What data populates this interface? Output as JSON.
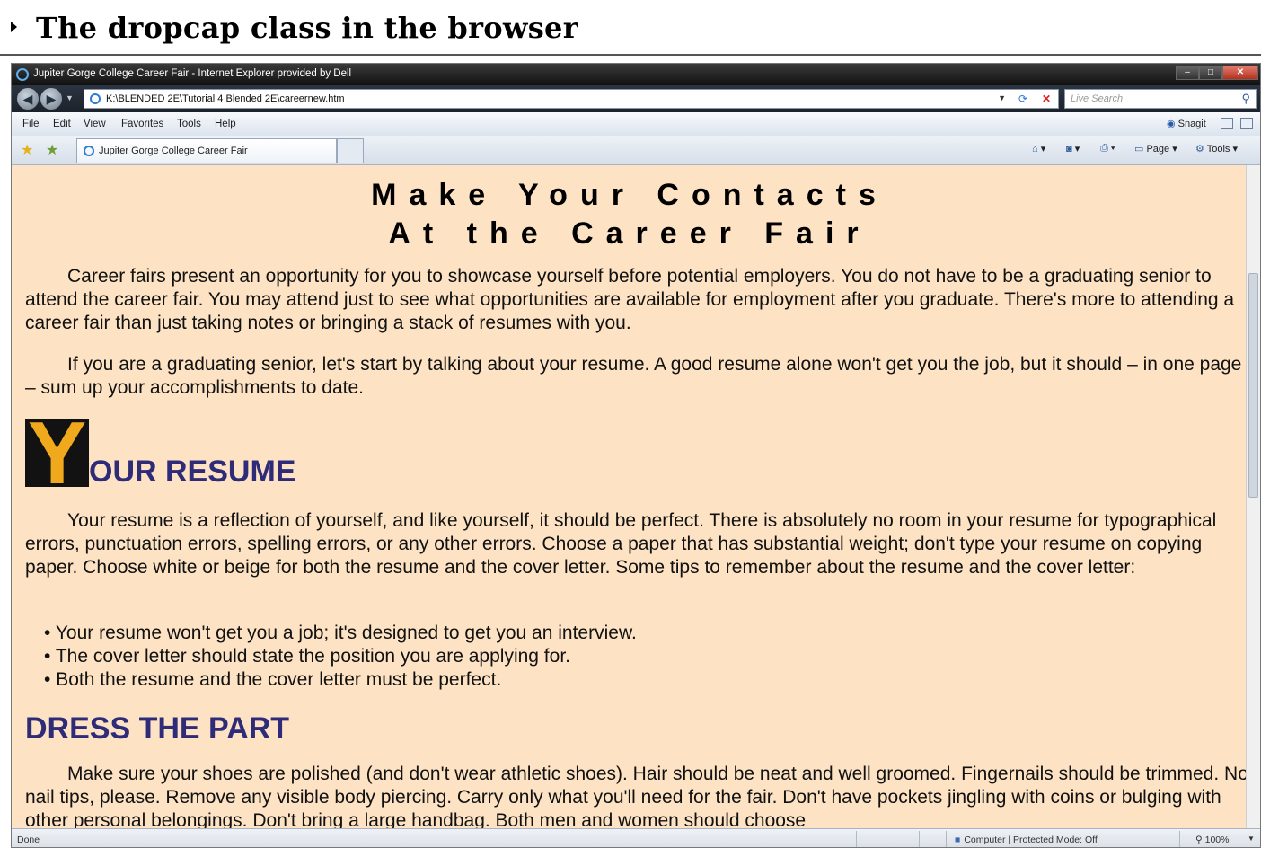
{
  "figure": {
    "caption": "The dropcap class in the browser"
  },
  "window": {
    "title": "Jupiter Gorge College Career Fair - Internet Explorer provided by Dell"
  },
  "address_bar": {
    "url": "K:\\BLENDED 2E\\Tutorial 4 Blended 2E\\careernew.htm",
    "search_placeholder": "Live Search"
  },
  "menu": {
    "items": [
      "File",
      "Edit",
      "View",
      "Favorites",
      "Tools",
      "Help"
    ],
    "snagit": "Snagit"
  },
  "tabs": [
    {
      "label": "Jupiter Gorge College Career Fair"
    }
  ],
  "command_bar": {
    "page_label": "Page",
    "tools_label": "Tools"
  },
  "page": {
    "heading_line1": "Make Your Contacts",
    "heading_line2": "At the Career Fair",
    "intro_paragraph_1": "Career fairs present an opportunity for you to showcase yourself before potential employers. You do not have to be a graduating senior to attend the career fair. You may attend just to see what opportunities are available for employment after you graduate. There's more to attending a career fair than just taking notes or bringing a stack of resumes with you.",
    "intro_paragraph_2": "If you are a graduating senior, let's start by talking about your resume. A good resume alone won't get you the job, but it should – in one page – sum up your accomplishments to date.",
    "resume_dropcap": "Y",
    "resume_heading_rest": "OUR RESUME",
    "resume_paragraph": "Your resume is a reflection of yourself, and like yourself, it should be perfect. There is absolutely no room in your resume for typographical errors, punctuation errors, spelling errors, or any other errors. Choose a paper that has substantial weight; don't type your resume on copying paper. Choose white or beige for both the resume and the cover letter. Some tips to remember about the resume and the cover letter:",
    "bullets": [
      "Your resume won't get you a job; it's designed to get you an interview.",
      "The cover letter should state the position you are applying for.",
      "Both the resume and the cover letter must be perfect."
    ],
    "dress_heading": "DRESS THE PART",
    "dress_paragraph": "Make sure your shoes are polished (and don't wear athletic shoes). Hair should be neat and well groomed. Fingernails should be trimmed. No nail tips, please. Remove any visible body piercing. Carry only what you'll need for the fair. Don't have pockets jingling with coins or bulging with other personal belongings. Don't bring a large handbag. Both men and women should choose"
  },
  "status_bar": {
    "status": "Done",
    "zone": "Computer | Protected Mode: Off",
    "zoom": "100%"
  },
  "colors": {
    "page_background": "#fde3c4",
    "heading_color": "#2e2b78",
    "dropcap_background": "#121212",
    "dropcap_letter": "#f0a81c"
  }
}
